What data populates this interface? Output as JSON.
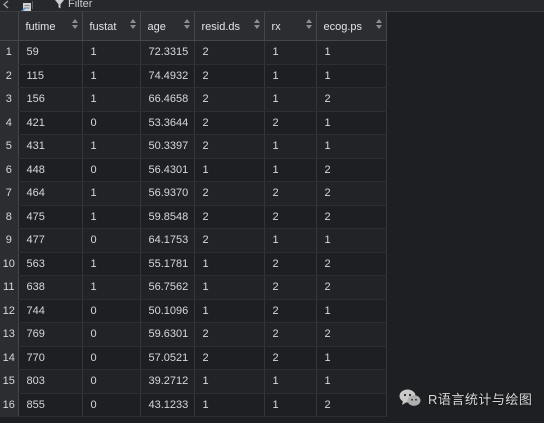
{
  "toolbar": {
    "filter_label": "Filter"
  },
  "table": {
    "columns": [
      "futime",
      "fustat",
      "age",
      "resid.ds",
      "rx",
      "ecog.ps"
    ],
    "rows": [
      {
        "n": "1",
        "cells": [
          "59",
          "1",
          "72.3315",
          "2",
          "1",
          "1"
        ]
      },
      {
        "n": "2",
        "cells": [
          "115",
          "1",
          "74.4932",
          "2",
          "1",
          "1"
        ]
      },
      {
        "n": "3",
        "cells": [
          "156",
          "1",
          "66.4658",
          "2",
          "1",
          "2"
        ]
      },
      {
        "n": "4",
        "cells": [
          "421",
          "0",
          "53.3644",
          "2",
          "2",
          "1"
        ]
      },
      {
        "n": "5",
        "cells": [
          "431",
          "1",
          "50.3397",
          "2",
          "1",
          "1"
        ]
      },
      {
        "n": "6",
        "cells": [
          "448",
          "0",
          "56.4301",
          "1",
          "1",
          "2"
        ]
      },
      {
        "n": "7",
        "cells": [
          "464",
          "1",
          "56.9370",
          "2",
          "2",
          "2"
        ]
      },
      {
        "n": "8",
        "cells": [
          "475",
          "1",
          "59.8548",
          "2",
          "2",
          "2"
        ]
      },
      {
        "n": "9",
        "cells": [
          "477",
          "0",
          "64.1753",
          "2",
          "1",
          "1"
        ]
      },
      {
        "n": "10",
        "cells": [
          "563",
          "1",
          "55.1781",
          "1",
          "2",
          "2"
        ]
      },
      {
        "n": "11",
        "cells": [
          "638",
          "1",
          "56.7562",
          "1",
          "2",
          "2"
        ]
      },
      {
        "n": "12",
        "cells": [
          "744",
          "0",
          "50.1096",
          "1",
          "2",
          "1"
        ]
      },
      {
        "n": "13",
        "cells": [
          "769",
          "0",
          "59.6301",
          "2",
          "2",
          "2"
        ]
      },
      {
        "n": "14",
        "cells": [
          "770",
          "0",
          "57.0521",
          "2",
          "2",
          "1"
        ]
      },
      {
        "n": "15",
        "cells": [
          "803",
          "0",
          "39.2712",
          "1",
          "1",
          "1"
        ]
      },
      {
        "n": "16",
        "cells": [
          "855",
          "0",
          "43.1233",
          "1",
          "1",
          "2"
        ]
      }
    ]
  },
  "watermark": {
    "text": "R语言统计与绘图"
  },
  "icons": {
    "back": "back-arrow-icon",
    "document": "document-icon",
    "filter": "filter-funnel-icon",
    "sort": "sort-arrows-icon"
  },
  "colors": {
    "background": "#1e1f22",
    "header": "#2b2d31",
    "text": "#d6d8dc"
  }
}
